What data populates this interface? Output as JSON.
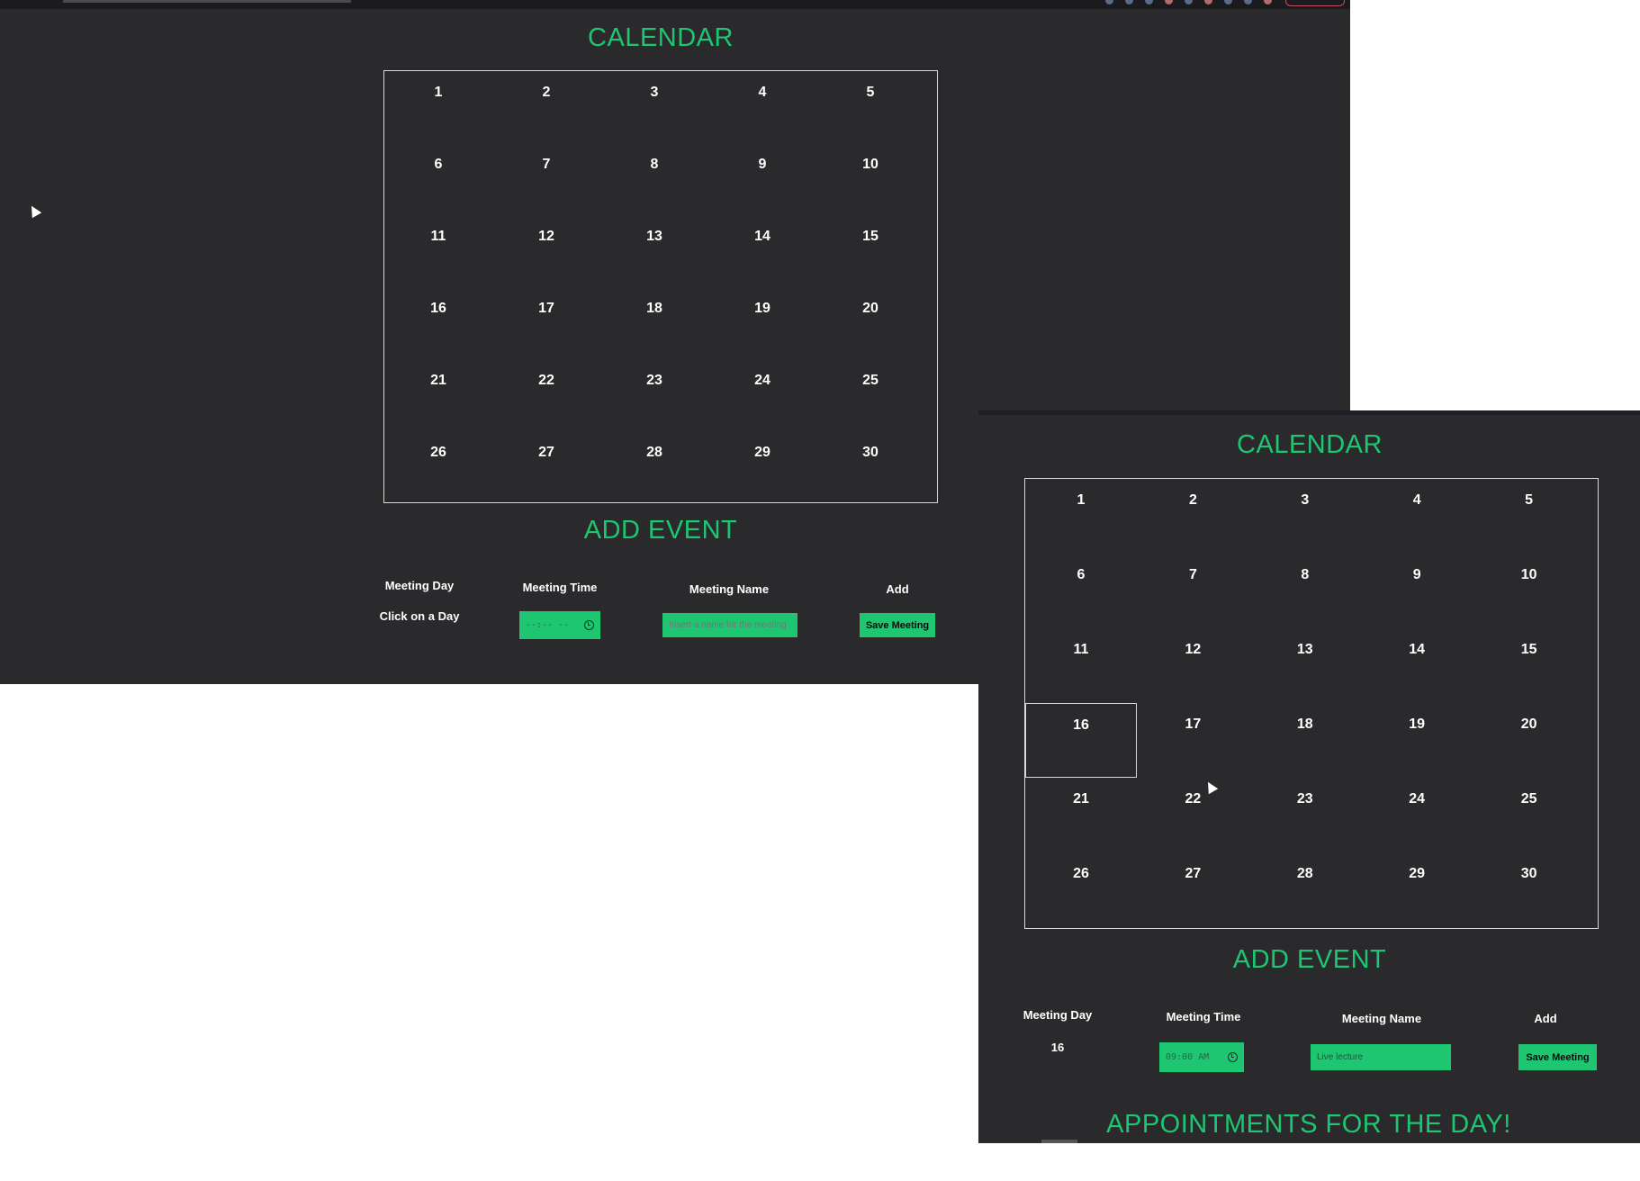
{
  "before": {
    "calendar_title": "CALENDAR",
    "days": [
      "1",
      "2",
      "3",
      "4",
      "5",
      "6",
      "7",
      "8",
      "9",
      "10",
      "11",
      "12",
      "13",
      "14",
      "15",
      "16",
      "17",
      "18",
      "19",
      "20",
      "21",
      "22",
      "23",
      "24",
      "25",
      "26",
      "27",
      "28",
      "29",
      "30"
    ],
    "add_event_title": "ADD EVENT",
    "form": {
      "day_label": "Meeting Day",
      "time_label": "Meeting Time",
      "name_label": "Meeting Name",
      "add_label": "Add",
      "day_value": "Click on a Day",
      "time_value": "--:-- --",
      "name_placeholder": "Insert a name for the meeting",
      "save_button": "Save Meeting"
    }
  },
  "after": {
    "calendar_title": "CALENDAR",
    "days": [
      "1",
      "2",
      "3",
      "4",
      "5",
      "6",
      "7",
      "8",
      "9",
      "10",
      "11",
      "12",
      "13",
      "14",
      "15",
      "16",
      "17",
      "18",
      "19",
      "20",
      "21",
      "22",
      "23",
      "24",
      "25",
      "26",
      "27",
      "28",
      "29",
      "30"
    ],
    "selected_day": "16",
    "add_event_title": "ADD EVENT",
    "form": {
      "day_label": "Meeting Day",
      "time_label": "Meeting Time",
      "name_label": "Meeting Name",
      "add_label": "Add",
      "day_value": "16",
      "time_value": "09:00 AM",
      "name_value": "Live lecture",
      "save_button": "Save Meeting"
    },
    "appointments_title": "APPOINTMENTS FOR THE DAY!"
  },
  "colors": {
    "background": "#2a292b",
    "accent": "#1ec672",
    "text": "#ffffff",
    "grid_border": "#d8d8d8"
  }
}
